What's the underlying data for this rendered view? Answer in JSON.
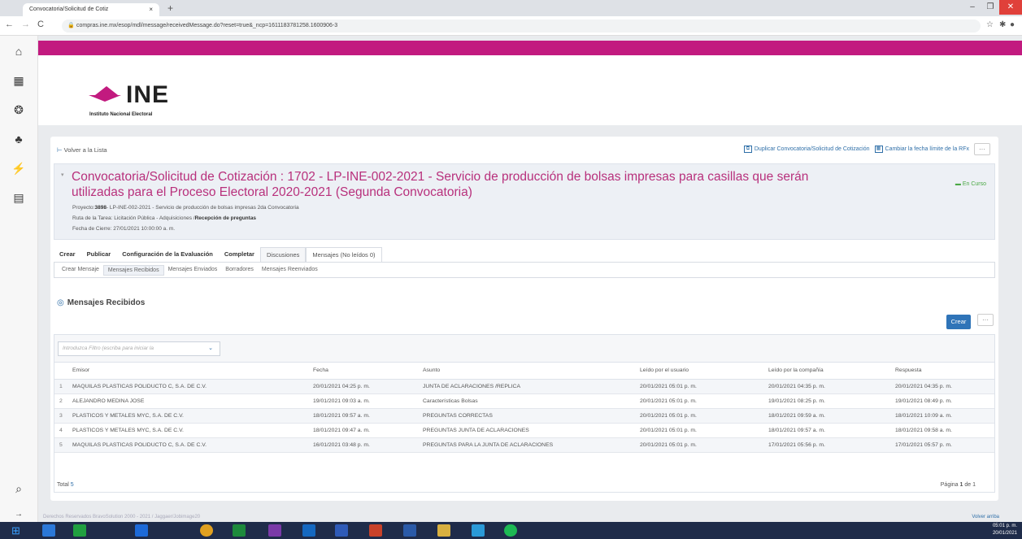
{
  "browser": {
    "tab_title": "Convocatoria/Solicitud de Cotiz",
    "tab_close": "×",
    "new_tab": "+",
    "url": "compras.ine.mx/esop/mdl/message/receivedMessage.do?reset=true&_ncp=1611183781258.1600906-3"
  },
  "logo": {
    "name": "INE",
    "subtitle": "Instituto Nacional Electoral"
  },
  "actions": {
    "back": "Volver a la Lista",
    "duplicate": "Duplicar Convocatoria/Solicitud de Cotización",
    "change_date": "Cambiar la fecha límite de la RFx",
    "more": "···"
  },
  "header": {
    "title": "Convocatoria/Solicitud de Cotización : 1702 - LP-INE-002-2021 - Servicio de producción de bolsas impresas para casillas que serán utilizadas para el Proceso Electoral 2020-2021 (Segunda Convocatoria)",
    "status": "En Curso",
    "proyecto_label": "Proyecto:",
    "proyecto_id": "3898",
    "proyecto_desc": "- LP-INE-002-2021 - Servicio de producción de bolsas impresas 2da Convocatoria",
    "ruta_label": "Ruta de la Tarea: Licitación Pública - Adquisiciones /",
    "ruta_stage": "Recepción de preguntas",
    "cierre": "Fecha de Cierre: 27/01/2021 10:00:00 a. m."
  },
  "tabs": [
    {
      "label": "Crear"
    },
    {
      "label": "Publicar"
    },
    {
      "label": "Configuración de la Evaluación"
    },
    {
      "label": "Completar"
    },
    {
      "label": "Discusiones"
    },
    {
      "label": "Mensajes (No leídos 0)"
    }
  ],
  "subtabs": [
    {
      "label": "Crear Mensaje"
    },
    {
      "label": "Mensajes Recibidos"
    },
    {
      "label": "Mensajes Enviados"
    },
    {
      "label": "Borradores"
    },
    {
      "label": "Mensajes Reenviados"
    }
  ],
  "section": {
    "icon": "◎",
    "title": "Mensajes Recibidos",
    "create": "Crear",
    "more": "···"
  },
  "filter": {
    "placeholder": "Introduzca Filtro (escriba para iniciar la",
    "chevron": "⌄"
  },
  "table": {
    "headers": [
      "Emisor",
      "Fecha",
      "Asunto",
      "Leído por el usuario",
      "Leído por la compañía",
      "Respuesta"
    ],
    "rows": [
      {
        "n": "1",
        "emisor": "MAQUILAS PLASTICAS POLIDUCTO C, S.A. DE C.V.",
        "fecha": "20/01/2021 04:25 p. m.",
        "asunto": "JUNTA DE ACLARACIONES /REPLICA",
        "lu": "20/01/2021 05:01 p. m.",
        "lc": "20/01/2021 04:35 p. m.",
        "resp": "20/01/2021 04:35 p. m."
      },
      {
        "n": "2",
        "emisor": "ALEJANDRO MEDINA JOSE",
        "fecha": "19/01/2021 09:03 a. m.",
        "asunto": "Características Bolsas",
        "lu": "20/01/2021 05:01 p. m.",
        "lc": "19/01/2021 08:25 p. m.",
        "resp": "19/01/2021 08:49 p. m."
      },
      {
        "n": "3",
        "emisor": "PLASTICOS Y METALES MYC, S.A. DE C.V.",
        "fecha": "18/01/2021 09:57 a. m.",
        "asunto": "PREGUNTAS CORRECTAS",
        "lu": "20/01/2021 05:01 p. m.",
        "lc": "18/01/2021 09:59 a. m.",
        "resp": "18/01/2021 10:09 a. m."
      },
      {
        "n": "4",
        "emisor": "PLASTICOS Y METALES MYC, S.A. DE C.V.",
        "fecha": "18/01/2021 09:47 a. m.",
        "asunto": "PREGUNTAS JUNTA DE ACLARACIONES",
        "lu": "20/01/2021 05:01 p. m.",
        "lc": "18/01/2021 09:57 a. m.",
        "resp": "18/01/2021 09:58 a. m."
      },
      {
        "n": "5",
        "emisor": "MAQUILAS PLASTICAS POLIDUCTO C, S.A. DE C.V.",
        "fecha": "16/01/2021 03:48 p. m.",
        "asunto": "PREGUNTAS PARA LA JUNTA DE ACLARACIONES",
        "lu": "20/01/2021 05:01 p. m.",
        "lc": "17/01/2021 05:56 p. m.",
        "resp": "17/01/2021 05:57 p. m."
      }
    ],
    "total_label": "Total",
    "total": "5",
    "page_label": "Página",
    "page": "1",
    "page_of": "de 1"
  },
  "footer": {
    "left": "Derechos Reservados BravoSolution 2000 - 2021 / Jaggaer/Jobimage20",
    "right": "Volver arriba"
  },
  "taskbar": {
    "time": "05:01 p. m.",
    "date": "20/01/2021"
  },
  "colors": {
    "brand": "#c21a7f",
    "link": "#2f6fa8",
    "status": "#4aa844",
    "primary_button": "#2f74b8"
  }
}
